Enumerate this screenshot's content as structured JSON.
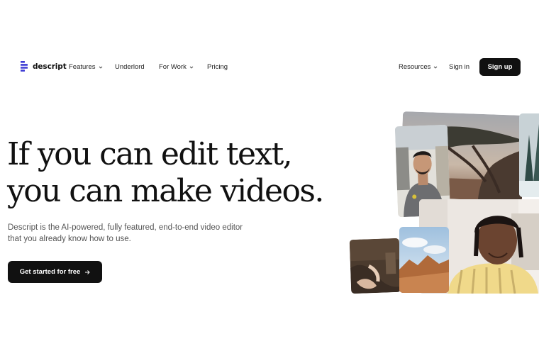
{
  "nav": {
    "brand": "descript",
    "links": [
      {
        "label": "Features",
        "has_dropdown": true
      },
      {
        "label": "Underlord",
        "has_dropdown": false
      },
      {
        "label": "For Work",
        "has_dropdown": true
      },
      {
        "label": "Pricing",
        "has_dropdown": false
      }
    ],
    "resources": {
      "label": "Resources",
      "has_dropdown": true
    },
    "sign_in": "Sign in",
    "sign_up": "Sign up"
  },
  "hero": {
    "headline_line1": "If you can edit text,",
    "headline_line2": "you can make videos.",
    "sub_line1": "Descript is the AI-powered, fully featured, end-to-end video editor",
    "sub_line2": "that you already know how to use.",
    "cta": "Get started for free"
  },
  "icons": {
    "logo": "descript-logo-icon",
    "dropdown": "chevron-down-icon",
    "cta_arrow": "arrow-right-icon"
  },
  "colors": {
    "background": "#ffffff",
    "text": "#111111",
    "button": "#111111",
    "button_text": "#ffffff",
    "subtext": "#555555",
    "logo_accent": "#3d3bd4"
  }
}
